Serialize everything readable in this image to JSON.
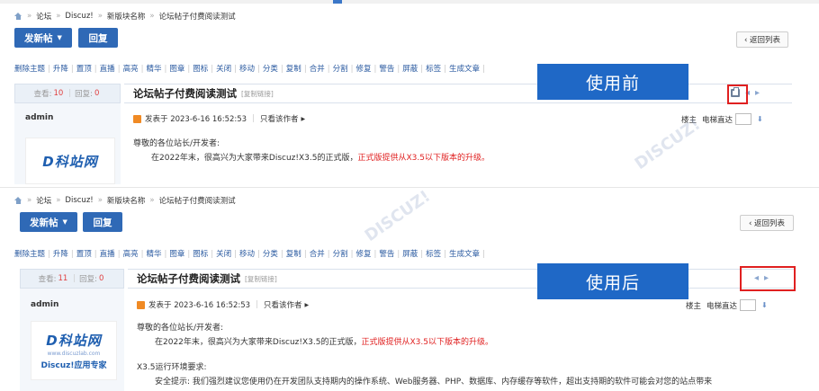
{
  "breadcrumb": {
    "items": [
      "论坛",
      "Discuz!",
      "新版块名称",
      "论坛帖子付费阅读测试"
    ],
    "separator": "»"
  },
  "toolbar": {
    "post_label": "发新帖",
    "reply_label": "回复",
    "back_label": "‹ 返回列表"
  },
  "mod_actions": [
    "删除主题",
    "升降",
    "置顶",
    "直播",
    "高亮",
    "精华",
    "图章",
    "图标",
    "关闭",
    "移动",
    "分类",
    "复制",
    "合并",
    "分割",
    "修复",
    "警告",
    "屏蔽",
    "标签",
    "生成文章"
  ],
  "thread": {
    "title": "论坛帖子付费阅读测试",
    "copy_link": "[复制链接]",
    "views_label": "查看:",
    "replies_label": "回复:",
    "author": "admin",
    "posted_at": "发表于 2023-6-16 16:52:53",
    "author_only": "只看该作者",
    "floor_label": "楼主",
    "jump_label": "电梯直达",
    "greeting": "尊敬的各位站长/开发者:",
    "body_line_prefix": "在2022年末，很高兴为大家带来Discuz!X3.5的正式版，",
    "body_line_highlight": "正式版提供从X3.5以下版本的升级。",
    "env_title": "X3.5运行环境要求:",
    "env_line": "安全提示: 我们强烈建议您使用仍在开发团队支持期内的操作系统、Web服务器、PHP、数据库、内存缓存等软件，超出支持期的软件可能会对您的站点带来"
  },
  "before": {
    "label": "使用前",
    "views": "10",
    "replies": "0"
  },
  "after": {
    "label": "使用后",
    "views": "11",
    "replies": "0"
  },
  "logo": {
    "mark": "D科站网",
    "url": "www.discuzlab.com",
    "expert": "Discuz!应用专家"
  },
  "colors": {
    "accent": "#2f69b6",
    "highlight": "#e02020",
    "label_bg": "#1f68c6"
  },
  "icons": [
    "home-icon",
    "print-icon",
    "prev-arrow-icon",
    "next-arrow-icon",
    "caret-down-icon",
    "floor-down-icon"
  ]
}
